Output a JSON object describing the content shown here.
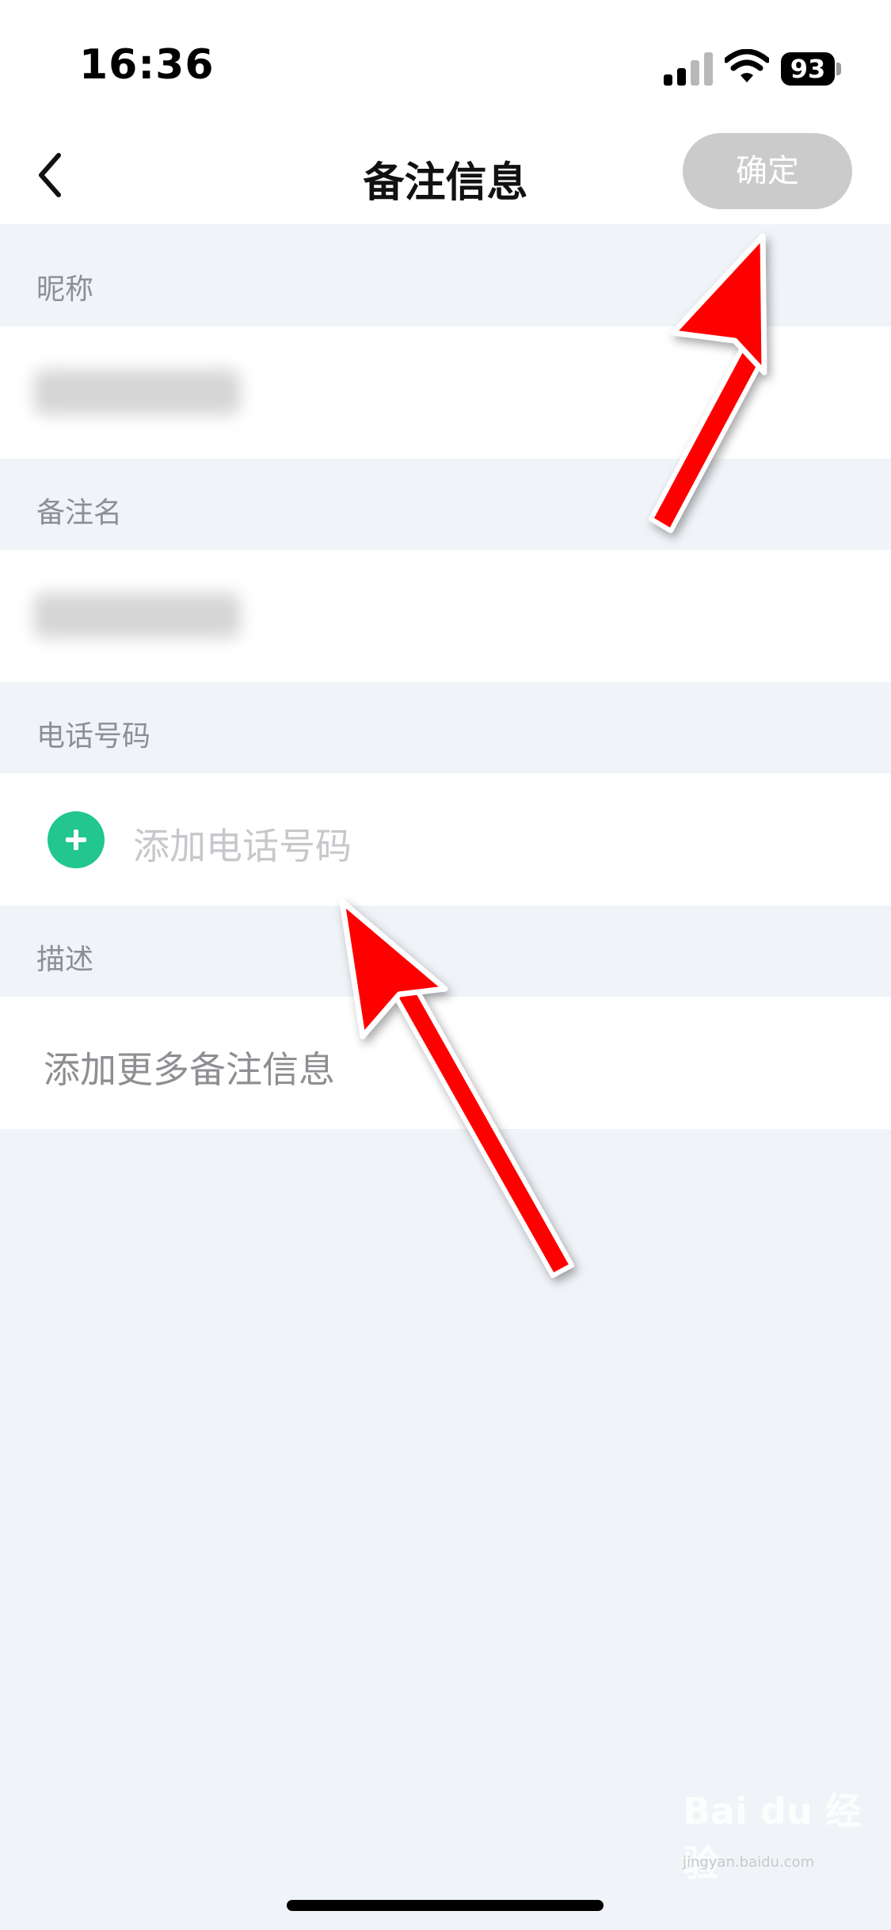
{
  "status_bar": {
    "time": "16:36",
    "battery": "93"
  },
  "nav": {
    "title": "备注信息",
    "confirm_label": "确定"
  },
  "sections": {
    "nickname": {
      "label": "昵称"
    },
    "remark_name": {
      "label": "备注名"
    },
    "phone": {
      "label": "电话号码",
      "placeholder": "添加电话号码"
    },
    "description": {
      "label": "描述",
      "placeholder": "添加更多备注信息"
    }
  },
  "colors": {
    "accent_green": "#22c68e",
    "confirm_disabled": "#cbcbcb",
    "annotation_red": "#ff0000"
  },
  "watermark": {
    "text": "Bai du 经验",
    "sub": "jingyan.baidu.com"
  }
}
